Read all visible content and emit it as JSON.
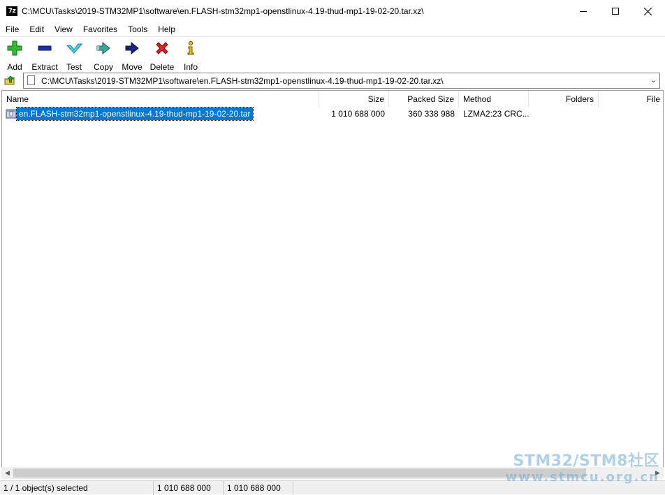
{
  "window": {
    "app_icon_text": "7z",
    "title": "C:\\MCU\\Tasks\\2019-STM32MP1\\software\\en.FLASH-stm32mp1-openstlinux-4.19-thud-mp1-19-02-20.tar.xz\\"
  },
  "menu": [
    "File",
    "Edit",
    "View",
    "Favorites",
    "Tools",
    "Help"
  ],
  "toolbar": {
    "add": "Add",
    "extract": "Extract",
    "test": "Test",
    "copy": "Copy",
    "move": "Move",
    "delete": "Delete",
    "info": "Info"
  },
  "address": {
    "path": "C:\\MCU\\Tasks\\2019-STM32MP1\\software\\en.FLASH-stm32mp1-openstlinux-4.19-thud-mp1-19-02-20.tar.xz\\"
  },
  "columns": {
    "name": "Name",
    "size": "Size",
    "packed_size": "Packed Size",
    "method": "Method",
    "folders": "Folders",
    "files": "File"
  },
  "rows": [
    {
      "name": "en.FLASH-stm32mp1-openstlinux-4.19-thud-mp1-19-02-20.tar",
      "size": "1 010 688 000",
      "packed_size": "360 338 988",
      "method": "LZMA2:23 CRC..."
    }
  ],
  "status": {
    "selection": "1 / 1 object(s) selected",
    "size": "1 010 688 000",
    "packed": "1 010 688 000"
  },
  "watermark": {
    "line1": "STM32/STM8社区",
    "line2": "www.stmcu.org.cn"
  },
  "colors": {
    "selection": "#0078d7",
    "add_icon": "#2dbe2d",
    "extract_icon": "#1a2fb0",
    "delete_icon": "#e02020",
    "info_icon": "#e8c020"
  }
}
